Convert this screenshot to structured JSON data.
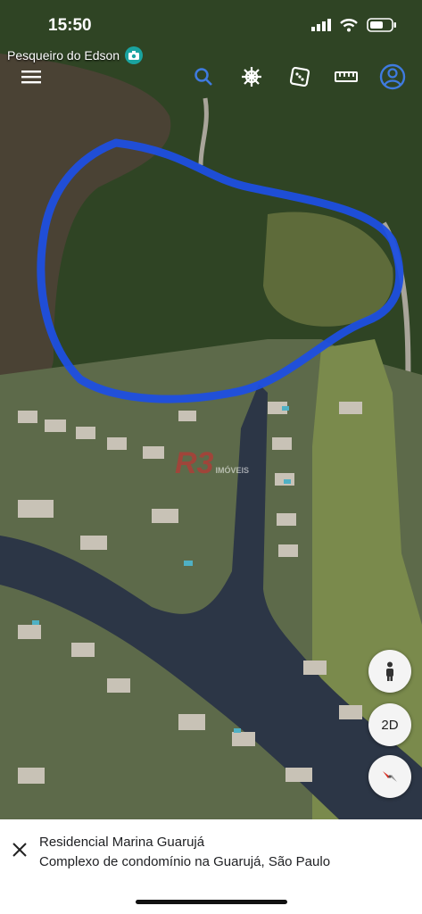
{
  "status_bar": {
    "time": "15:50"
  },
  "map": {
    "poi_label": "Pesqueiro do Edson",
    "highlight_color": "#1d4fe0",
    "watermark_text": "R3",
    "watermark_sub": "IMÓVEIS",
    "toolbar": {
      "menu": "menu-icon",
      "search": "search-icon",
      "voyager": "ship-wheel-icon",
      "feeling_lucky": "dice-icon",
      "measure": "ruler-icon",
      "account": "account-icon"
    },
    "controls": {
      "pegman": "person-icon",
      "view_mode_label": "2D",
      "compass": "compass-icon"
    }
  },
  "place_sheet": {
    "title": "Residencial Marina Guarujá",
    "subtitle": "Complexo de condomínio na Guarujá, São Paulo"
  }
}
